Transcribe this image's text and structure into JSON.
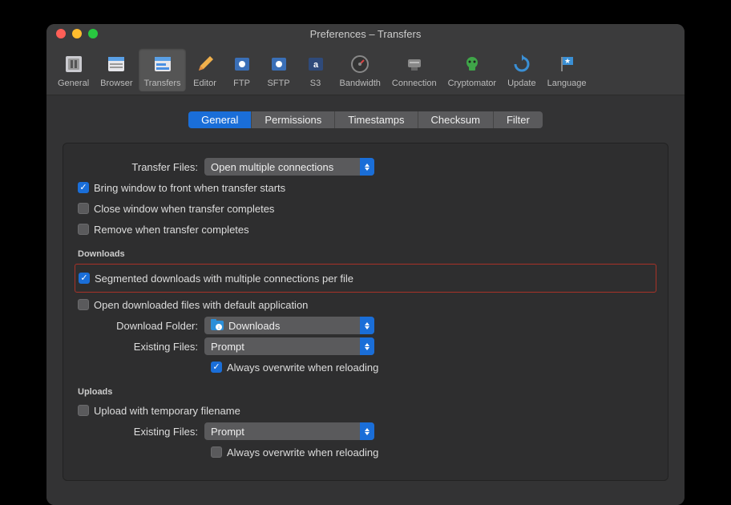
{
  "window": {
    "title": "Preferences – Transfers"
  },
  "toolbar": {
    "items": [
      {
        "name": "general",
        "label": "General"
      },
      {
        "name": "browser",
        "label": "Browser"
      },
      {
        "name": "transfers",
        "label": "Transfers"
      },
      {
        "name": "editor",
        "label": "Editor"
      },
      {
        "name": "ftp",
        "label": "FTP"
      },
      {
        "name": "sftp",
        "label": "SFTP"
      },
      {
        "name": "s3",
        "label": "S3"
      },
      {
        "name": "bandwidth",
        "label": "Bandwidth"
      },
      {
        "name": "connection",
        "label": "Connection"
      },
      {
        "name": "cryptomator",
        "label": "Cryptomator"
      },
      {
        "name": "update",
        "label": "Update"
      },
      {
        "name": "language",
        "label": "Language"
      }
    ]
  },
  "tabs": [
    "General",
    "Permissions",
    "Timestamps",
    "Checksum",
    "Filter"
  ],
  "labels": {
    "transfer_files": "Transfer Files:",
    "download_folder": "Download Folder:",
    "existing_files_d": "Existing Files:",
    "existing_files_u": "Existing Files:"
  },
  "selects": {
    "transfer_files": "Open multiple connections",
    "download_folder": "Downloads",
    "existing_files_d": "Prompt",
    "existing_files_u": "Prompt"
  },
  "checks": {
    "bring_front": "Bring window to front when transfer starts",
    "close_complete": "Close window when transfer completes",
    "remove_complete": "Remove when transfer completes",
    "segmented": "Segmented downloads with multiple connections per file",
    "open_downloaded": "Open downloaded files with default application",
    "overwrite_reload_d": "Always overwrite when reloading",
    "upload_temp": "Upload with temporary filename",
    "overwrite_reload_u": "Always overwrite when reloading"
  },
  "sections": {
    "downloads": "Downloads",
    "uploads": "Uploads"
  }
}
